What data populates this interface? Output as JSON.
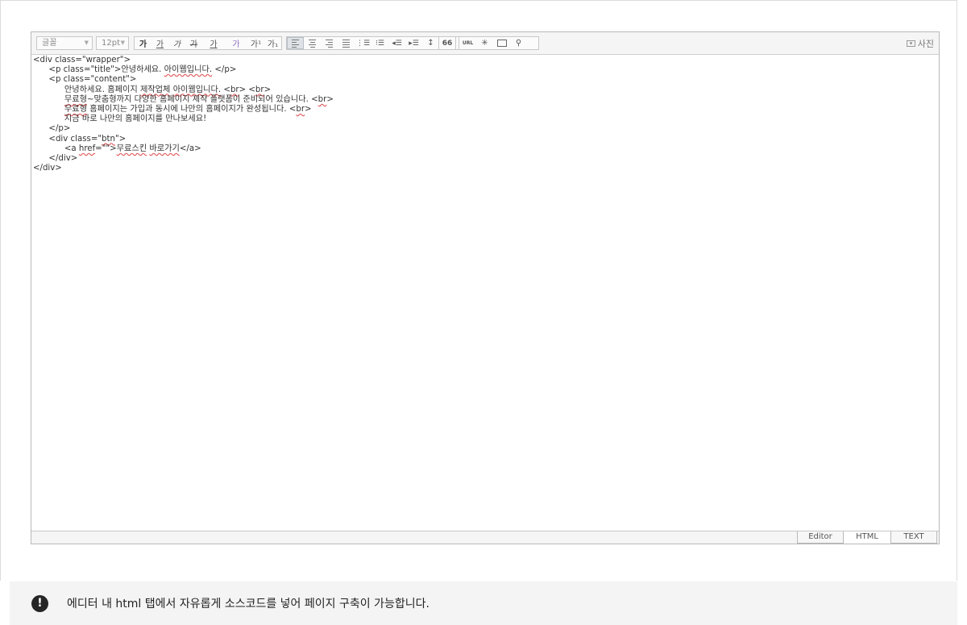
{
  "toolbar": {
    "font_select": "글꼴",
    "size_select": "12pt",
    "format_buttons": [
      "가",
      "가",
      "가",
      "가",
      "가",
      "가",
      "가¹",
      "가₁"
    ],
    "quote_label": "66",
    "url_label": "URL",
    "photo_label": "사진"
  },
  "code_lines": [
    "<div class=\"wrapper\">",
    "      <p class=\"title\">안녕하세요. 아이웹입니다. </p>",
    "      <p class=\"content\">",
    "            안녕하세요. 홈페이지 제작업체 아이웹입니다. <br> <br>",
    "            무료형~맞춤형까지 다양한 홈페이지 제작 플랫폼이 준비되어 있습니다. <br>",
    "            무료형 홈페이지는 가입과 동시에 나만의 홈페이지가 완성됩니다. <br>",
    "            지금 바로 나만의 홈페이지를 만나보세요!",
    "      </p>",
    "      <div class=\"btn\">",
    "            <a href=\"\">무료스킨 바로가기</a>",
    "      </div>",
    "</div>"
  ],
  "mode_tabs": {
    "editor": "Editor",
    "html": "HTML",
    "text": "TEXT",
    "selected": "HTML"
  },
  "notice": {
    "icon": "!",
    "text": "에디터 내 html 탭에서 자유롭게 소스코드를 넣어 페이지 구축이 가능합니다."
  }
}
